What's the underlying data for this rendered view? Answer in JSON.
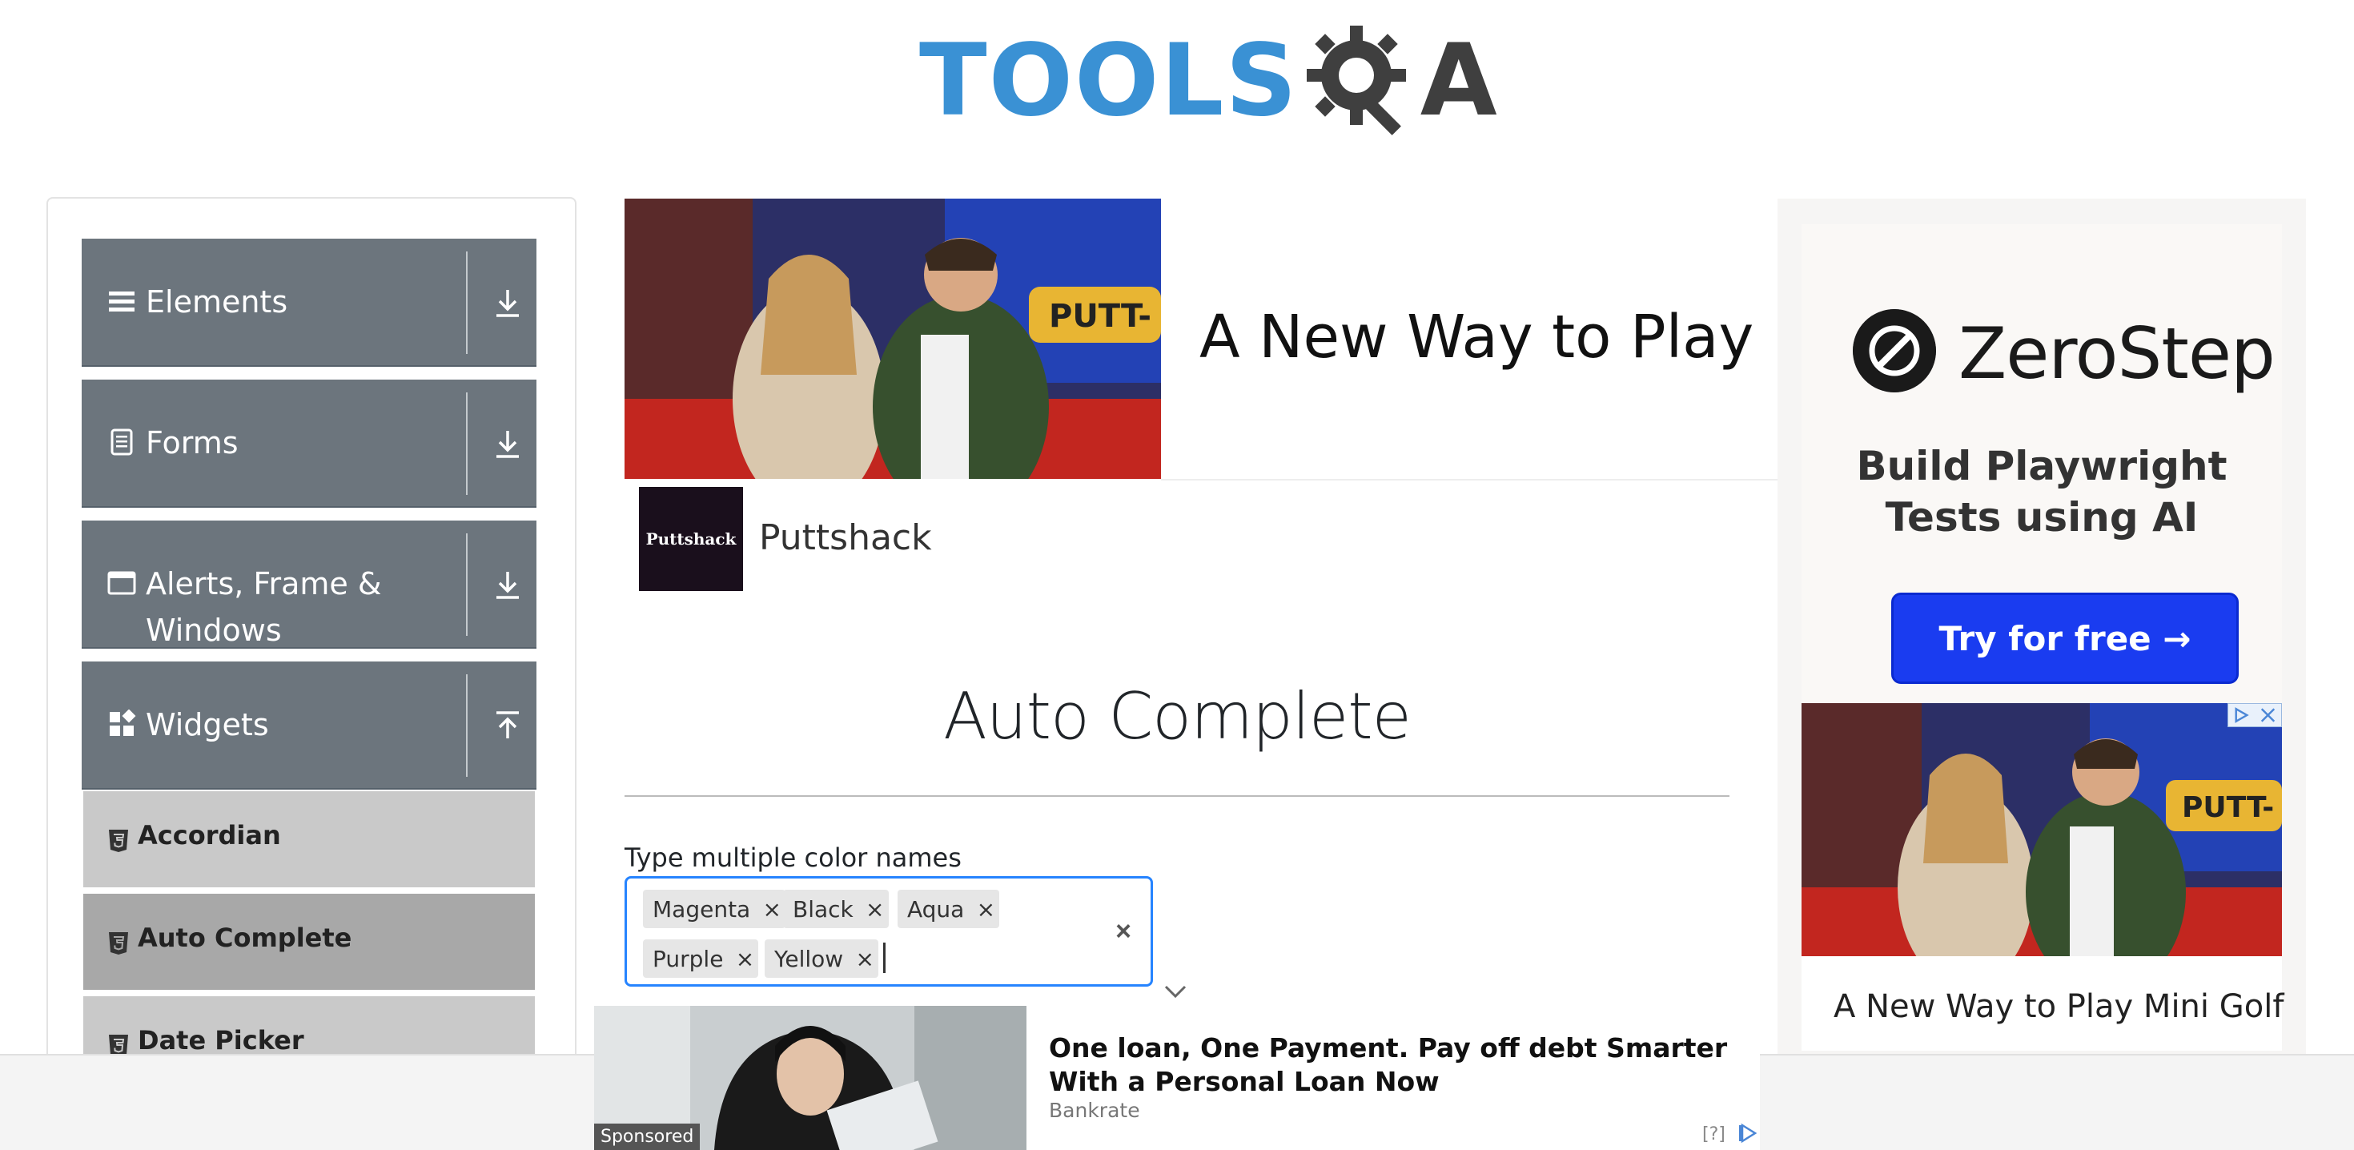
{
  "header": {
    "logo_text_blue": "TOOLS",
    "logo_text_dark": "A",
    "logo_alt": "TOOLSQA"
  },
  "sidebar": {
    "groups": [
      {
        "label": "Elements",
        "icon": "hamburger-icon",
        "arrow": "download-arrow-icon"
      },
      {
        "label": "Forms",
        "icon": "document-icon",
        "arrow": "download-arrow-icon"
      },
      {
        "label": "Alerts, Frame & Windows",
        "line1": "Alerts, Frame &",
        "line2": "Windows",
        "icon": "window-icon",
        "arrow": "download-arrow-icon"
      },
      {
        "label": "Widgets",
        "icon": "widgets-icon",
        "arrow": "upload-arrow-icon"
      }
    ],
    "widget_items": [
      {
        "label": "Accordian",
        "active": false
      },
      {
        "label": "Auto Complete",
        "active": true
      },
      {
        "label": "Date Picker",
        "active": false
      }
    ]
  },
  "top_ad": {
    "headline": "A New Way to Play Mini Golf",
    "brand_logo_text": "Puttshack",
    "brand_name": "Puttshack",
    "photo_sign": "PUTT-"
  },
  "main": {
    "title": "Auto Complete",
    "multi_label": "Type multiple color names",
    "chips": [
      {
        "label": "Magenta",
        "remove": "×"
      },
      {
        "label": "Black",
        "remove": "×"
      },
      {
        "label": "Aqua",
        "remove": "×"
      },
      {
        "label": "Purple",
        "remove": "×"
      },
      {
        "label": "Yellow",
        "remove": "×"
      }
    ],
    "clear_glyph": "×"
  },
  "right_ad": {
    "brand": "ZeroStep",
    "tagline_line1": "Build Playwright",
    "tagline_line2": "Tests using AI",
    "cta": "Try for free →",
    "headline": "A New Way to Play Mini Golf",
    "photo_sign": "PUTT-"
  },
  "bottom_ad": {
    "sponsored": "Sponsored",
    "title": "One loan, One Payment. Pay off debt Smarter With a Personal Loan Now",
    "source": "Bankrate",
    "help": "[?]"
  },
  "colors": {
    "accent_blue": "#2684ff",
    "sidebar_header": "#6c757d",
    "cta_blue": "#1a3cf0",
    "logo_blue": "#3a91d4"
  }
}
